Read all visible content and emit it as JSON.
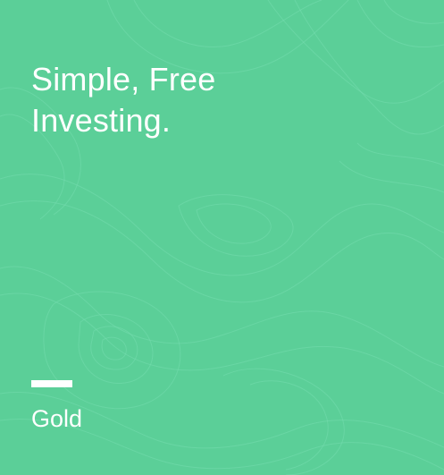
{
  "card": {
    "headline_line1": "Simple, Free",
    "headline_line2": "Investing.",
    "category": "Gold",
    "background_color": "#5bcf98",
    "pattern": "topographic-contour-lines"
  }
}
